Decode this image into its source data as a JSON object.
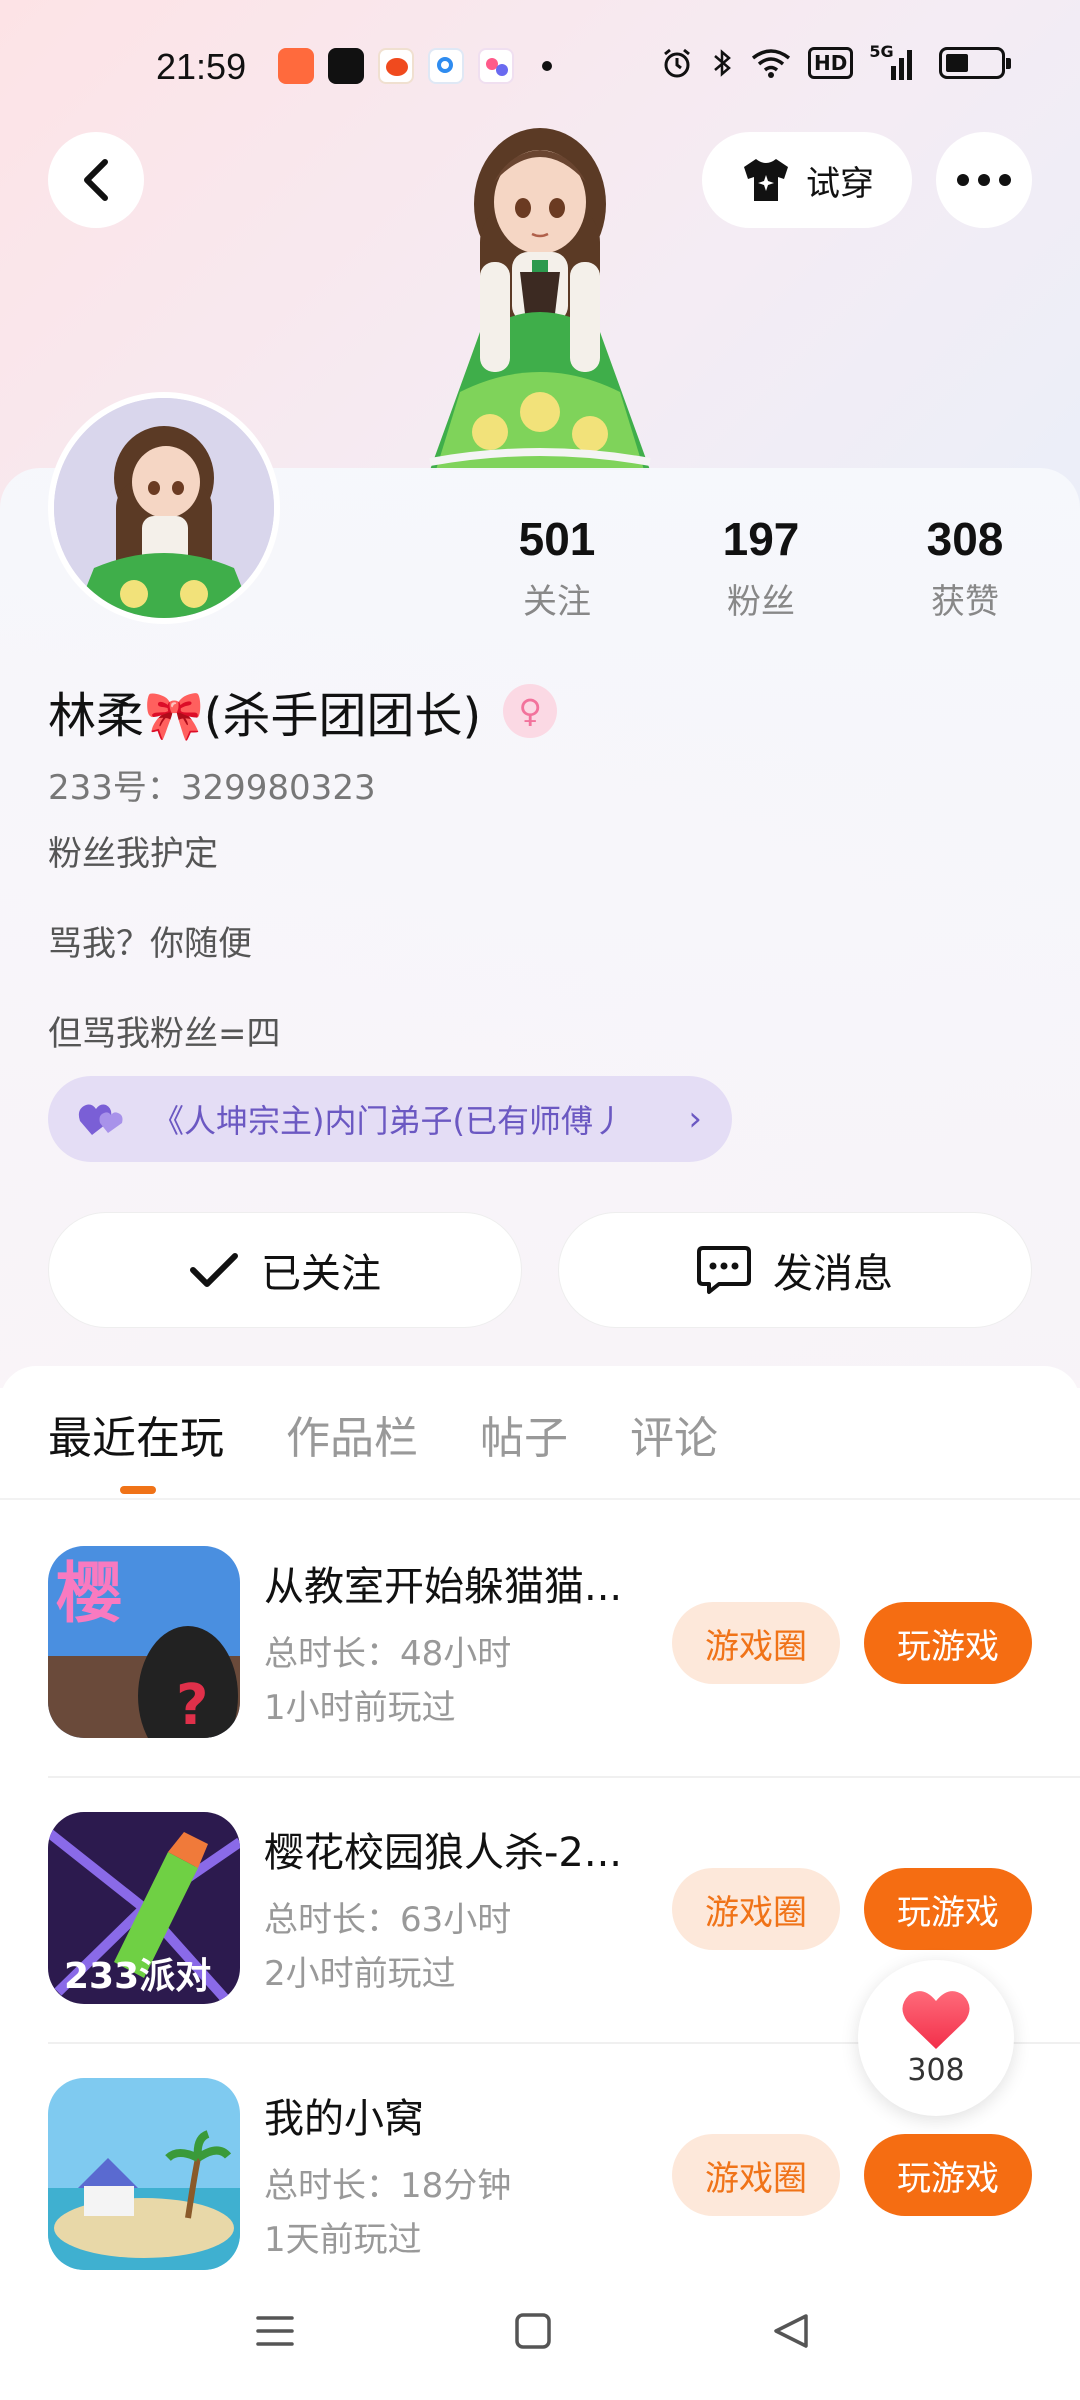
{
  "status_bar": {
    "time": "21:59",
    "app_icons": [
      "video-app-icon",
      "tiktok-icon",
      "weibo-icon",
      "search-app-icon",
      "party-app-icon"
    ],
    "network": "5G",
    "hd_label": "HD"
  },
  "header": {
    "tryon_label": "试穿"
  },
  "profile": {
    "stats": [
      {
        "value": "501",
        "label": "关注"
      },
      {
        "value": "197",
        "label": "粉丝"
      },
      {
        "value": "308",
        "label": "获赞"
      }
    ],
    "nickname": "林柔🎀(杀手团团长)",
    "uid": "233号：329980323",
    "bio_lines": [
      "粉丝我护定",
      "骂我？你随便",
      "但骂我粉丝=四"
    ],
    "sect_text": "《人坤宗主)内门弟子(已有师傅丿",
    "follow_label": "已关注",
    "message_label": "发消息"
  },
  "tabs": [
    {
      "label": "最近在玩",
      "active": true
    },
    {
      "label": "作品栏",
      "active": false
    },
    {
      "label": "帖子",
      "active": false
    },
    {
      "label": "评论",
      "active": false
    }
  ],
  "games": [
    {
      "title": "从教室开始躲猫猫...",
      "duration": "总时长：48小时",
      "last_played": "1小时前玩过",
      "circle_label": "游戏圈",
      "play_label": "玩游戏",
      "icon_text": "樱"
    },
    {
      "title": "樱花校园狼人杀-2...",
      "duration": "总时长：63小时",
      "last_played": "2小时前玩过",
      "circle_label": "游戏圈",
      "play_label": "玩游戏",
      "icon_text": "233派对"
    },
    {
      "title": "我的小窝",
      "duration": "总时长：18分钟",
      "last_played": "1天前玩过",
      "circle_label": "游戏圈",
      "play_label": "玩游戏",
      "icon_text": ""
    }
  ],
  "like_bubble": {
    "count": "308"
  },
  "colors": {
    "accent": "#f56d12",
    "accent_light": "#fde8da",
    "sect_bg": "#e4ddf5",
    "sect_text": "#6b58c2"
  }
}
